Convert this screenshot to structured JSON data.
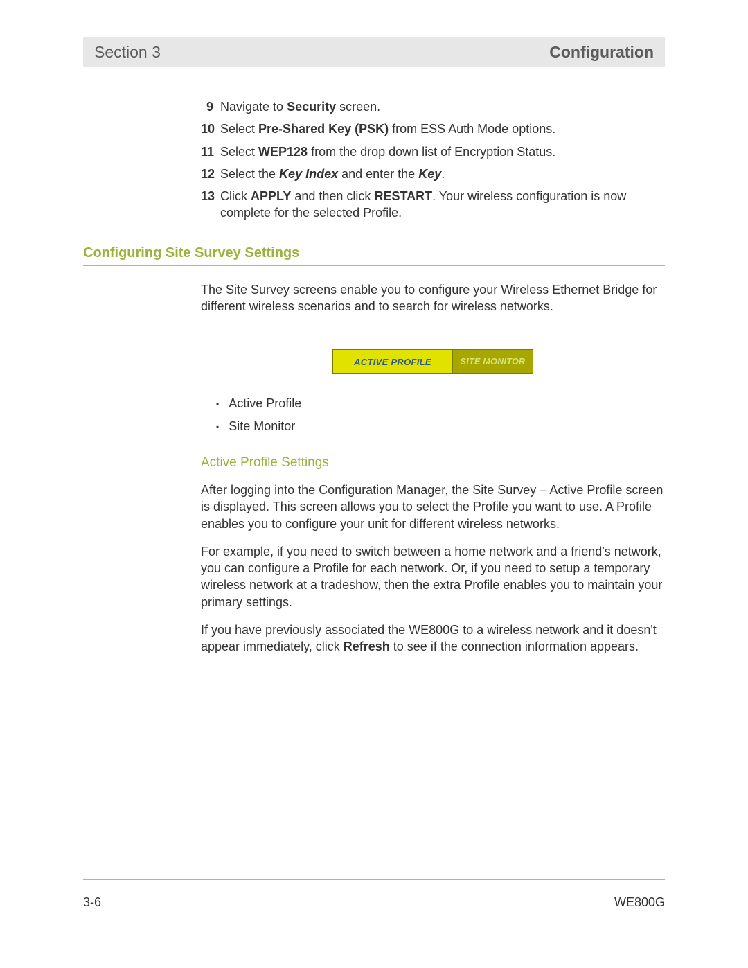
{
  "header": {
    "left": "Section 3",
    "right": "Configuration"
  },
  "steps": [
    {
      "num": "9",
      "html": "Navigate to <b>Security</b> screen."
    },
    {
      "num": "10",
      "html": "Select <b>Pre-Shared Key (PSK)</b> from ESS Auth Mode options."
    },
    {
      "num": "11",
      "html": "Select <b>WEP128</b> from the drop down list of Encryption Status."
    },
    {
      "num": "12",
      "html": "Select the <i>Key Index</i> and enter the <i>Key</i>."
    },
    {
      "num": "13",
      "html": "Click <b>APPLY</b> and then click <b>RESTART</b>. Your wireless configuration is now complete for the selected Profile."
    }
  ],
  "section_heading": "Configuring Site Survey Settings",
  "intro_para": "The Site Survey screens enable you to configure your Wireless Ethernet Bridge for different wireless scenarios and to search for wireless networks.",
  "tabs": {
    "active": "ACTIVE PROFILE",
    "inactive": "SITE MONITOR"
  },
  "bullets": [
    "Active Profile",
    "Site Monitor"
  ],
  "sub_heading": "Active Profile Settings",
  "para1": "After logging into the Configuration Manager, the Site Survey – Active Profile screen is displayed. This screen allows you to select the Profile you want to use. A Profile enables you to configure your unit for different wireless networks.",
  "para2": "For example, if you need to switch between a home network and a friend's network, you can configure a Profile for each network. Or, if you need to setup a temporary wireless network at a tradeshow, then the extra Profile enables you to maintain your primary settings.",
  "para3_html": "If you have previously associated the WE800G to a wireless network and it doesn't appear immediately, click <b>Refresh</b> to see if the connection information appears.",
  "footer": {
    "left": "3-6",
    "right": "WE800G"
  }
}
